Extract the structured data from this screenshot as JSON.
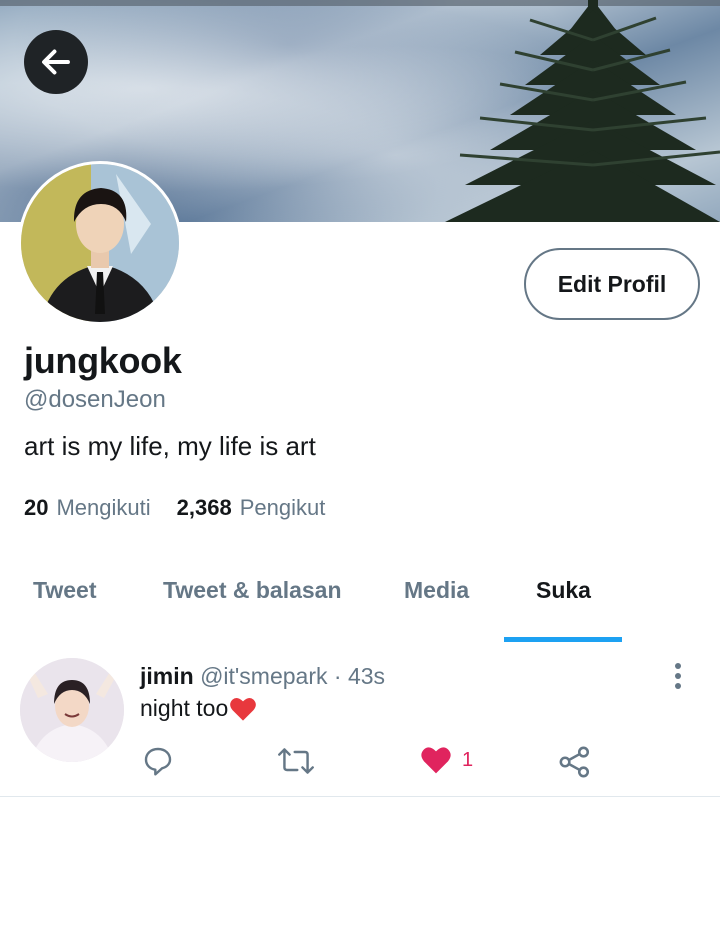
{
  "header": {
    "back_icon": "arrow-left-icon",
    "edit_button_label": "Edit Profil"
  },
  "profile": {
    "name": "jungkook",
    "handle": "@dosenJeon",
    "bio": "art is my life, my life is art",
    "following_count": "20",
    "following_label": "Mengikuti",
    "followers_count": "2,368",
    "followers_label": "Pengikut"
  },
  "tabs": [
    {
      "label": "Tweet",
      "active": false
    },
    {
      "label": "Tweet & balasan",
      "active": false
    },
    {
      "label": "Media",
      "active": false
    },
    {
      "label": "Suka",
      "active": true
    }
  ],
  "tweets": [
    {
      "name": "jimin",
      "handle": "@it'smepark",
      "separator": "·",
      "time": "43s",
      "text": "night too",
      "emoji": "heart",
      "like_count": "1",
      "liked": true
    }
  ],
  "colors": {
    "accent": "#1da1f2",
    "muted": "#657786",
    "like": "#e0245e"
  }
}
